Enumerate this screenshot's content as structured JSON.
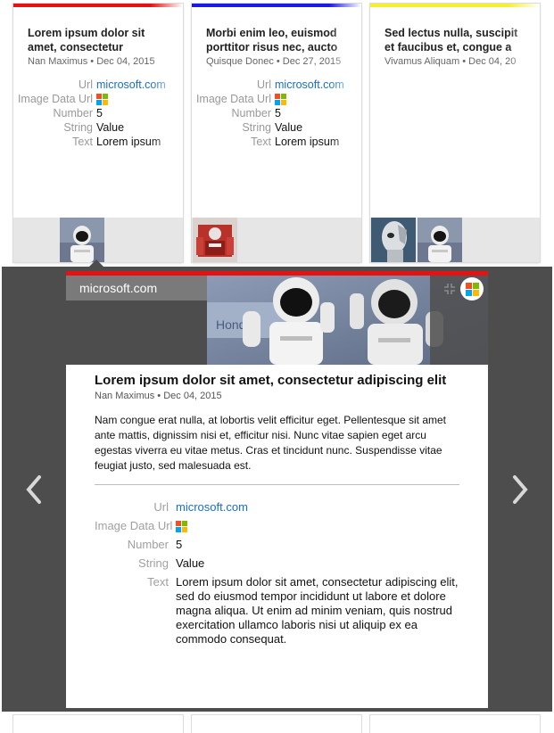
{
  "cards": [
    {
      "accent": "#e81111",
      "title": "Lorem ipsum dolor sit amet, consectetur",
      "meta": "Nan Maximus • Dec 04, 2015",
      "props": [
        {
          "label": "Url",
          "value": "microsoft.com"
        },
        {
          "label": "Image Data Url",
          "value": "microsoft-logo"
        },
        {
          "label": "Number",
          "value": "5"
        },
        {
          "label": "String",
          "value": "Value"
        },
        {
          "label": "Text",
          "value": "Lorem ipsum"
        }
      ],
      "thumbnails": [
        "robot-thumbnail"
      ]
    },
    {
      "accent": "#1a1ae6",
      "title": "Morbi enim leo, euismod porttitor risus nec, aucto",
      "meta": "Quisque Donec • Dec 27, 2015",
      "props": [
        {
          "label": "Url",
          "value": "microsoft.com"
        },
        {
          "label": "Image Data Url",
          "value": "microsoft-logo"
        },
        {
          "label": "Number",
          "value": "5"
        },
        {
          "label": "String",
          "value": "Value"
        },
        {
          "label": "Text",
          "value": "Lorem ipsum"
        }
      ],
      "thumbnails": [
        "red-robot-thumbnail"
      ]
    },
    {
      "accent": "#f5f02a",
      "title": "Sed lectus nulla, suscipit et faucibus et, congue a",
      "meta": "Vivamus Aliquam • Dec 04, 20",
      "props": [],
      "thumbnails": [
        "android-thumbnail",
        "robot-thumbnail"
      ]
    }
  ],
  "detail": {
    "domain": "microsoft.com",
    "title": "Lorem ipsum dolor sit amet, consectetur adipiscing elit",
    "meta": "Nan Maximus • Dec 04, 2015",
    "body": "Nam congue erat nulla, at lobortis velit efficitur eget. Pellentesque sit amet ante mattis, dignissim nisi et, efficitur nisi. Nunc vitae sapien eget arcu egestas viverra eu vitae metus. Cras et tincidunt nunc. Suspendisse vitae feugiat justo, sed malesuada est.",
    "labels": {
      "url": "Url",
      "image": "Image Data Url",
      "number": "Number",
      "string": "String",
      "text": "Text"
    },
    "values": {
      "url": "microsoft.com",
      "number": "5",
      "string": "Value",
      "text": "Lorem ipsum dolor sit amet, consectetur adipiscing elit, sed do eiusmod tempor incididunt ut labore et dolore magna aliqua. Ut enim ad minim veniam, quis nostrud exercitation ullamco laboris nisi ut aliquip ex ea commodo consequat."
    },
    "icons": {
      "prev": "chevron-left-icon",
      "next": "chevron-right-icon",
      "collapse": "collapse-icon",
      "logo": "microsoft-logo"
    }
  },
  "colors": {
    "link": "#1b6fc1",
    "overlay": "#4d4d4d",
    "ms_red": "#f25022",
    "ms_green": "#7fba00",
    "ms_blue": "#00a4ef",
    "ms_yellow": "#ffb900"
  }
}
